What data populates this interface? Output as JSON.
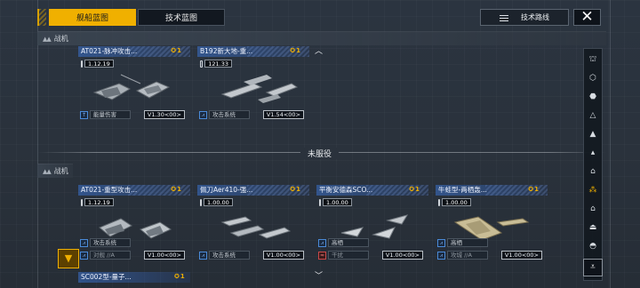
{
  "tabs": {
    "active": "舰船蓝图",
    "inactive": "技术蓝图"
  },
  "route_button": "技术路线",
  "close_symbol": "✕",
  "sections": {
    "fighter_top": "战机",
    "fighter_bottom": "战机"
  },
  "divider_label": "未服役",
  "top_cards": [
    {
      "name": "AT021-脉冲攻击...",
      "badge": "1",
      "level": "1.12.19",
      "tag": "能量伤害",
      "version": "V1.30<00>"
    },
    {
      "name": "B192新大地-重...",
      "badge": "1",
      "level": "121.33",
      "tag": "攻击系统",
      "version": "V1.54<00>"
    }
  ],
  "bottom_cards": [
    {
      "name": "AT021-重型攻击...",
      "badge": "1",
      "level": "1.12.19",
      "tag1": "攻击系统",
      "tag2": "对舰",
      "tag2_extra": "//A",
      "version": "V1.00<00>"
    },
    {
      "name": "佩刀Aer410-强...",
      "badge": "1",
      "level": "1.00.00",
      "tag1": "攻击系统",
      "version": "V1.00<00>"
    },
    {
      "name": "平衡安德森SCO...",
      "badge": "1",
      "level": "1.00.00",
      "tag1": "高栖",
      "tag2": "干扰",
      "version": "V1.00<00>"
    },
    {
      "name": "牛蛙型-两栖轰...",
      "badge": "1",
      "level": "1.00.00",
      "tag1": "高栖",
      "tag2": "攻城",
      "tag2_extra": "//A",
      "version": "V1.00<00>"
    }
  ],
  "partial_card": {
    "name": "SC002型-量子...",
    "badge": "1"
  },
  "sidebar_icons": [
    "carrier-icon",
    "cruiser-icon",
    "destroyer-icon",
    "frigate-icon",
    "corvette-icon",
    "gunship-icon",
    "interceptor-icon",
    "fighter-icon",
    "hangar-icon",
    "station-icon",
    "support-icon",
    "drone-icon"
  ],
  "colors": {
    "accent": "#f0b000",
    "card_head": "#3c78dc",
    "background": "#2a323c"
  }
}
